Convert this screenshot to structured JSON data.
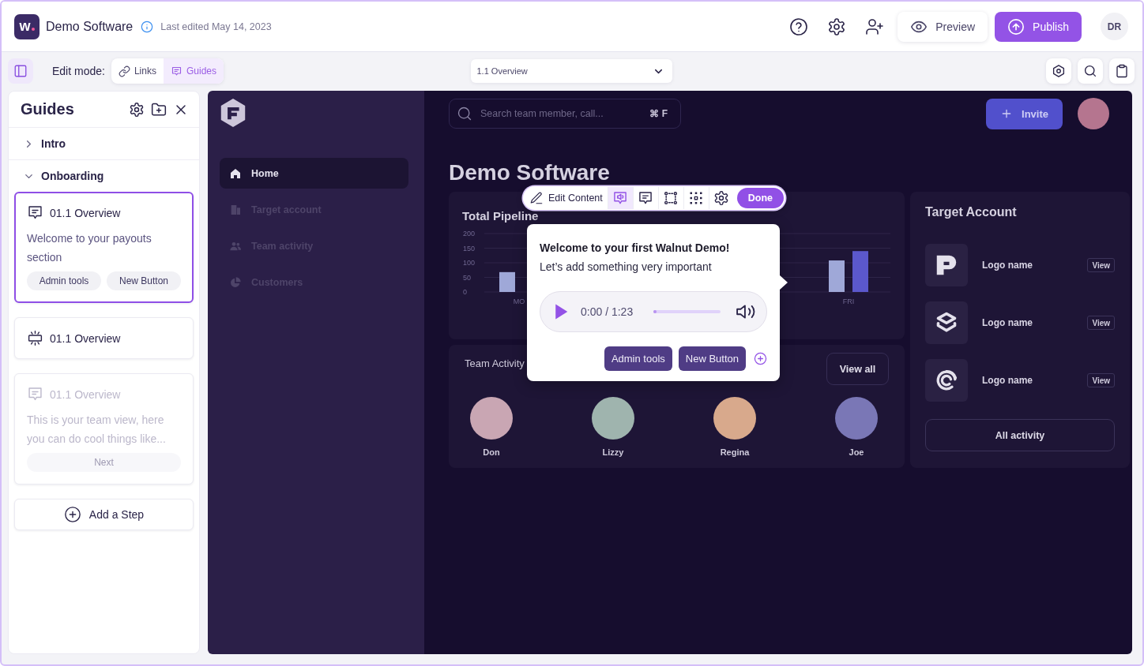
{
  "app": {
    "logo_text": "w",
    "title": "Demo Software",
    "last_edited": "Last edited May 14, 2023"
  },
  "top_actions": {
    "preview": "Preview",
    "publish": "Publish",
    "avatar": "DR"
  },
  "edit_bar": {
    "label": "Edit mode:",
    "modes": [
      {
        "kind": "links",
        "label": "Links",
        "selected": false
      },
      {
        "kind": "guides",
        "label": "Guides",
        "selected": true
      }
    ],
    "page_select": "1.1 Overview"
  },
  "guides_panel": {
    "title": "Guides",
    "sections": [
      {
        "title": "Intro",
        "expanded": false
      },
      {
        "title": "Onboarding",
        "expanded": true,
        "steps": [
          {
            "kind": "tooltip",
            "title": "01.1 Overview",
            "selected": true,
            "disabled": false,
            "text": "Welcome to your payouts section",
            "buttons": [
              "Admin tools",
              "New Button"
            ]
          },
          {
            "kind": "hotspot",
            "title": "01.1 Overview",
            "selected": false,
            "disabled": false
          },
          {
            "kind": "tooltip",
            "title": "01.1 Overview",
            "selected": false,
            "disabled": true,
            "text": "This is your team view, here you can do cool things like...",
            "buttons": [
              "Next"
            ]
          }
        ]
      }
    ],
    "add_step": "Add a Step"
  },
  "demo": {
    "nav": [
      {
        "kind": "home",
        "label": "Home",
        "selected": true
      },
      {
        "kind": "building",
        "label": "Target account",
        "selected": false
      },
      {
        "kind": "people",
        "label": "Team activity",
        "selected": false
      },
      {
        "kind": "pie",
        "label": "Customers",
        "selected": false
      }
    ],
    "search": {
      "placeholder": "Search team member, call...",
      "shortcut": "⌘ F"
    },
    "invite": "Invite",
    "heading": "Demo Software",
    "pipeline": {
      "title": "Total Pipeline",
      "chart_data": {
        "type": "bar",
        "categories": [
          "MO",
          "FRI"
        ],
        "series": [
          {
            "color": "#9fa8d8",
            "values": [
              68,
              108
            ]
          },
          {
            "color": "#5b58cc",
            "values": [
              null,
              140
            ]
          }
        ],
        "ylim": [
          0,
          200
        ],
        "yticks": [
          0,
          50,
          100,
          150,
          200
        ],
        "grid": true
      }
    },
    "team": {
      "title": "Team Activity",
      "view_all": "View all",
      "members": [
        {
          "name": "Don",
          "color": "#c9a6b3"
        },
        {
          "name": "Lizzy",
          "color": "#9fb4ae"
        },
        {
          "name": "Regina",
          "color": "#d8a98c"
        },
        {
          "name": "Joe",
          "color": "#7a77b6"
        }
      ]
    },
    "target": {
      "title": "Target Account",
      "accounts": [
        {
          "kind": "block",
          "name": "Logo name",
          "action": "View"
        },
        {
          "kind": "stack",
          "name": "Logo name",
          "action": "View"
        },
        {
          "kind": "arcs",
          "name": "Logo name",
          "action": "View"
        }
      ],
      "all_activity": "All activity"
    }
  },
  "guide_popup": {
    "toolbar": {
      "edit_label": "Edit Content",
      "tools": [
        {
          "kind": "audio",
          "selected": true
        },
        {
          "kind": "comment",
          "selected": false
        },
        {
          "kind": "frame",
          "selected": false
        },
        {
          "kind": "grid",
          "selected": false
        },
        {
          "kind": "settings",
          "selected": false
        }
      ],
      "done": "Done"
    },
    "title": "Welcome to your first Walnut Demo!",
    "text": "Let’s add something very important",
    "audio": {
      "time": "0:00 / 1:23",
      "level": 0
    },
    "buttons": [
      "Admin tools",
      "New Button"
    ]
  }
}
